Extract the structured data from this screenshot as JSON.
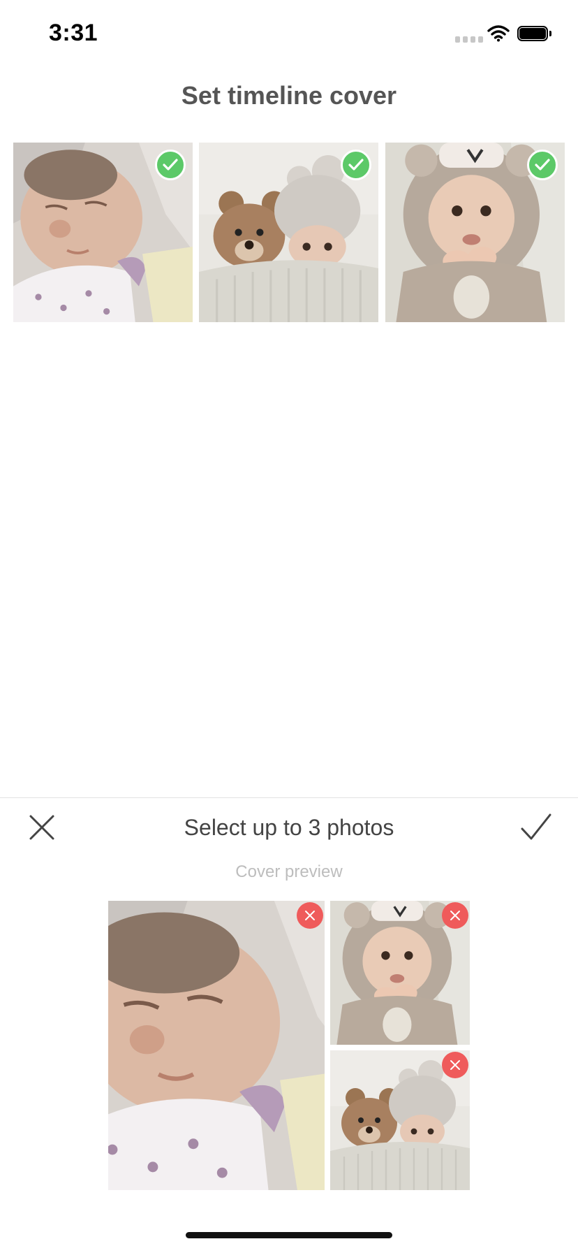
{
  "status_bar": {
    "time": "3:31",
    "icons": [
      "cellular-signal-icon",
      "wifi-icon",
      "battery-icon"
    ]
  },
  "header": {
    "title": "Set timeline cover"
  },
  "photo_grid": {
    "photos": [
      {
        "subject": "sleeping newborn",
        "selected": true
      },
      {
        "subject": "baby in knit hat with teddy bear",
        "selected": true
      },
      {
        "subject": "baby in bear hood costume",
        "selected": true
      }
    ]
  },
  "bottom_panel": {
    "title": "Select up to 3 photos",
    "preview_label": "Cover preview",
    "close_icon": "close-icon",
    "confirm_icon": "checkmark-icon",
    "preview_photos": [
      {
        "subject": "sleeping newborn",
        "removable": true
      },
      {
        "subject": "baby in bear hood costume",
        "removable": true
      },
      {
        "subject": "baby in knit hat with teddy bear",
        "removable": true
      }
    ]
  },
  "colors": {
    "selected_badge": "#5cc968",
    "remove_badge": "#ef5b5b",
    "title_text": "#555555",
    "preview_label_text": "#bdbdbd"
  }
}
